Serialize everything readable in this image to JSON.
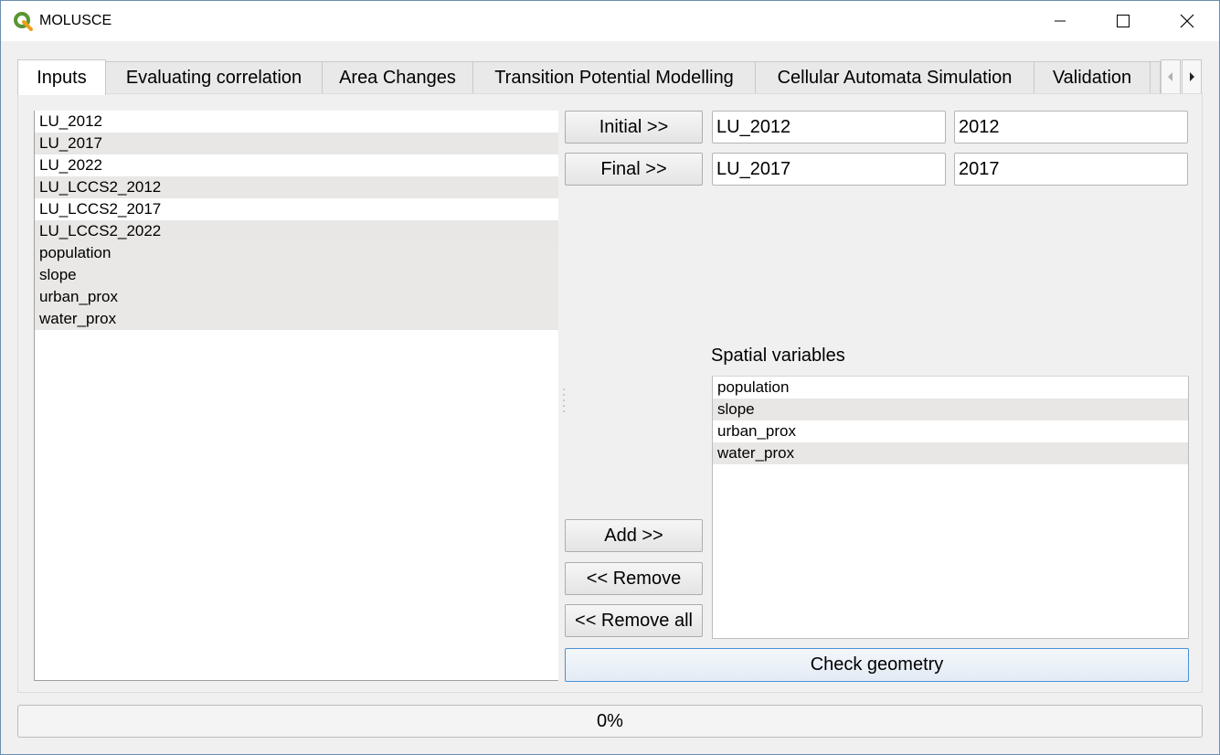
{
  "window": {
    "title": "MOLUSCE",
    "icon": "qgis-logo-icon",
    "controls": [
      "minimize-icon",
      "maximize-icon",
      "close-icon"
    ]
  },
  "tabs": [
    {
      "label": "Inputs",
      "active": true
    },
    {
      "label": "Evaluating correlation",
      "active": false
    },
    {
      "label": "Area Changes",
      "active": false
    },
    {
      "label": "Transition Potential Modelling",
      "active": false
    },
    {
      "label": "Cellular Automata Simulation",
      "active": false
    },
    {
      "label": "Validation",
      "active": false
    }
  ],
  "tab_scroll": {
    "left_icon": "arrow-left-icon",
    "right_icon": "arrow-right-icon"
  },
  "rasters": [
    "LU_2012",
    "LU_2017",
    "LU_2022",
    "LU_LCCS2_2012",
    "LU_LCCS2_2017",
    "LU_LCCS2_2022",
    "population",
    "slope",
    "urban_prox",
    "water_prox"
  ],
  "initial": {
    "button": "Initial >>",
    "layer": "LU_2012",
    "year": "2012"
  },
  "final": {
    "button": "Final >>",
    "layer": "LU_2017",
    "year": "2017"
  },
  "spatial": {
    "label": "Spatial variables",
    "items": [
      "population",
      "slope",
      "urban_prox",
      "water_prox"
    ]
  },
  "buttons": {
    "add": "Add >>",
    "remove": "<< Remove",
    "remove_all": "<< Remove all",
    "check_geometry": "Check geometry"
  },
  "progress": {
    "value": 0,
    "label": "0%"
  },
  "colors": {
    "progress_fill": "#06b025",
    "focus_border": "#4a90d9",
    "row_alt": "#e8e7e5"
  }
}
